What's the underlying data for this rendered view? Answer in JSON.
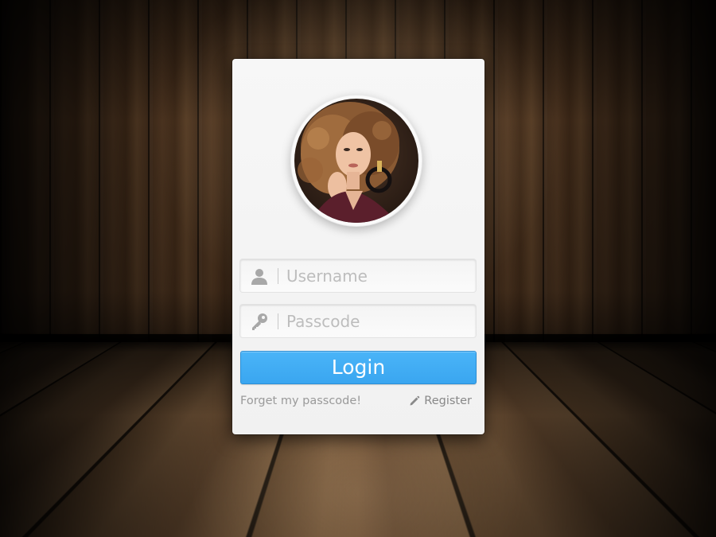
{
  "background": {
    "scene": "wood-room"
  },
  "login_card": {
    "avatar": {
      "icon": "user-portrait"
    },
    "username": {
      "placeholder": "Username",
      "value": "",
      "icon": "user-icon"
    },
    "passcode": {
      "placeholder": "Passcode",
      "value": "",
      "icon": "key-icon"
    },
    "login_label": "Login",
    "forget_label": "Forget my passcode!",
    "register_label": "Register",
    "register_icon": "pencil-icon"
  },
  "colors": {
    "accent": "#3aa6f0",
    "card": "#f4f4f4",
    "placeholder": "#bdbdbd",
    "link": "#9a9a9a"
  }
}
